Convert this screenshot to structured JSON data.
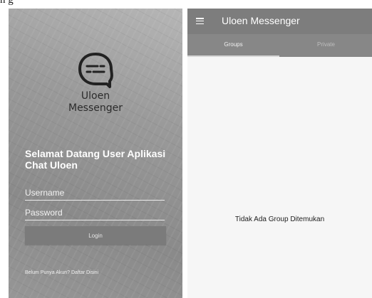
{
  "caption": "n g",
  "login": {
    "logo_text_line1": "Uloen",
    "logo_text_line2": "Messenger",
    "welcome": "Selamat Datang User Aplikasi Chat Uloen",
    "username_placeholder": "Username",
    "password_placeholder": "Password",
    "login_label": "Login",
    "register_link": "Belum Punya Akun? Daftar Disini",
    "logo_icon": "chat-bubble-icon"
  },
  "messenger": {
    "title": "Uloen Messenger",
    "menu_icon": "hamburger-menu-icon",
    "tabs": [
      {
        "label": "Groups",
        "selected": true
      },
      {
        "label": "Private",
        "selected": false
      }
    ],
    "empty_message": "Tidak Ada Group Ditemukan"
  },
  "colors": {
    "appbar": "#7d7d7d",
    "tabbar": "#878787",
    "login_button": "#7b7b7b"
  }
}
